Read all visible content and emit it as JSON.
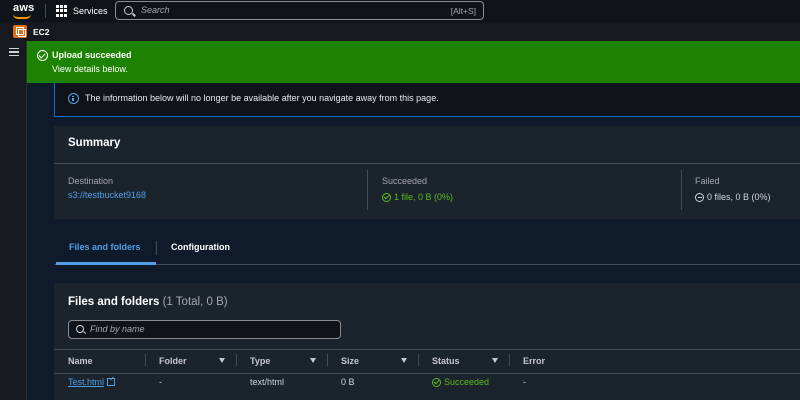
{
  "topnav": {
    "logo_text": "aws",
    "services_label": "Services",
    "search_placeholder": "Search",
    "search_shortcut": "[Alt+S]"
  },
  "subbar": {
    "service_label": "EC2"
  },
  "flash": {
    "title": "Upload succeeded",
    "description": "View details below.",
    "color": "#1d8102"
  },
  "info": {
    "text": "The information below will no longer be available after you navigate away from this page."
  },
  "summary": {
    "title": "Summary",
    "destination_label": "Destination",
    "destination_value": "s3://testbucket9168",
    "succeeded_label": "Succeeded",
    "succeeded_value": "1 file, 0 B (0%)",
    "failed_label": "Failed",
    "failed_value": "0 files, 0 B (0%)"
  },
  "tabs": [
    {
      "label": "Files and folders",
      "active": true
    },
    {
      "label": "Configuration",
      "active": false
    }
  ],
  "files": {
    "title": "Files and folders",
    "count": "(1 Total, 0 B)",
    "filter_placeholder": "Find by name",
    "columns": [
      "Name",
      "Folder",
      "Type",
      "Size",
      "Status",
      "Error"
    ],
    "rows": [
      {
        "name": "Test.html",
        "folder": "-",
        "type": "text/html",
        "size": "0 B",
        "status": "Succeeded",
        "error": "-"
      }
    ]
  },
  "colors": {
    "accent": "#539fe5",
    "success": "#5dbb1e",
    "background": "#0f1b2a"
  }
}
